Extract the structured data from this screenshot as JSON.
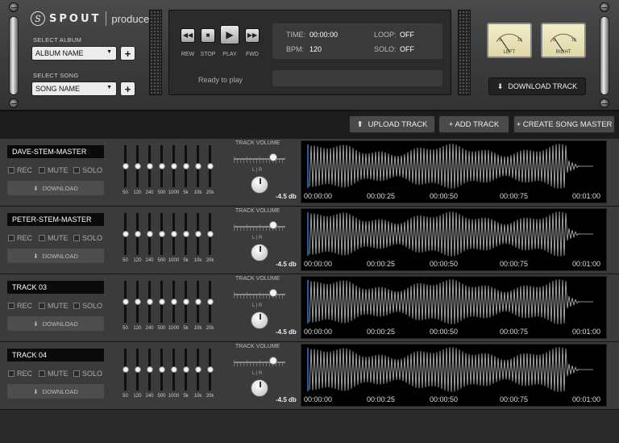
{
  "app": {
    "brand": "SPOUT",
    "product": "producer"
  },
  "header": {
    "album_label": "SELECT ALBUM",
    "album_value": "ALBUM NAME",
    "song_label": "SELECT SONG",
    "song_value": "SONG NAME",
    "plus": "+",
    "download_track": "DOWNLOAD TRACK",
    "meters": [
      {
        "label": "LEFT",
        "scale_low": "0",
        "scale_high": "10",
        "level": 0.12
      },
      {
        "label": "RIGHT",
        "scale_low": "0",
        "scale_high": "10",
        "level": 0.12
      }
    ]
  },
  "transport": {
    "rew": "REW",
    "stop": "STOP",
    "play": "PLAY",
    "fwd": "FWD",
    "status": "Ready to play",
    "time_label": "TIME:",
    "time_value": "00:00:00",
    "bpm_label": "BPM:",
    "bpm_value": "120",
    "loop_label": "LOOP:",
    "loop_value": "OFF",
    "solo_label": "SOLO:",
    "solo_value": "OFF"
  },
  "actions": {
    "upload_track": "UPLOAD TRACK",
    "add_track": "+ ADD TRACK",
    "create_song_master": "+ CREATE SONG MASTER"
  },
  "track_labels": {
    "rec": "REC",
    "mute": "MUTE",
    "solo": "SOLO",
    "download": "DOWNLOAD",
    "track_volume": "TRACK VOLUME",
    "lr": "L | R",
    "db": "-4.5 db",
    "eq_bands": [
      "50",
      "120",
      "240",
      "500",
      "1000",
      "5k",
      "10k",
      "20k"
    ],
    "timestamps": [
      "00:00:00",
      "00:00:25",
      "00:00:50",
      "00:00:75",
      "00:01:00"
    ]
  },
  "tracks": [
    {
      "name": "DAVE-STEM-MASTER"
    },
    {
      "name": "PETER-STEM-MASTER"
    },
    {
      "name": "TRACK 03"
    },
    {
      "name": "TRACK 04"
    }
  ],
  "colors": {
    "accent": "#2f7bd8",
    "waveform": "#bfbfbf",
    "panel": "#3b3b3b"
  }
}
